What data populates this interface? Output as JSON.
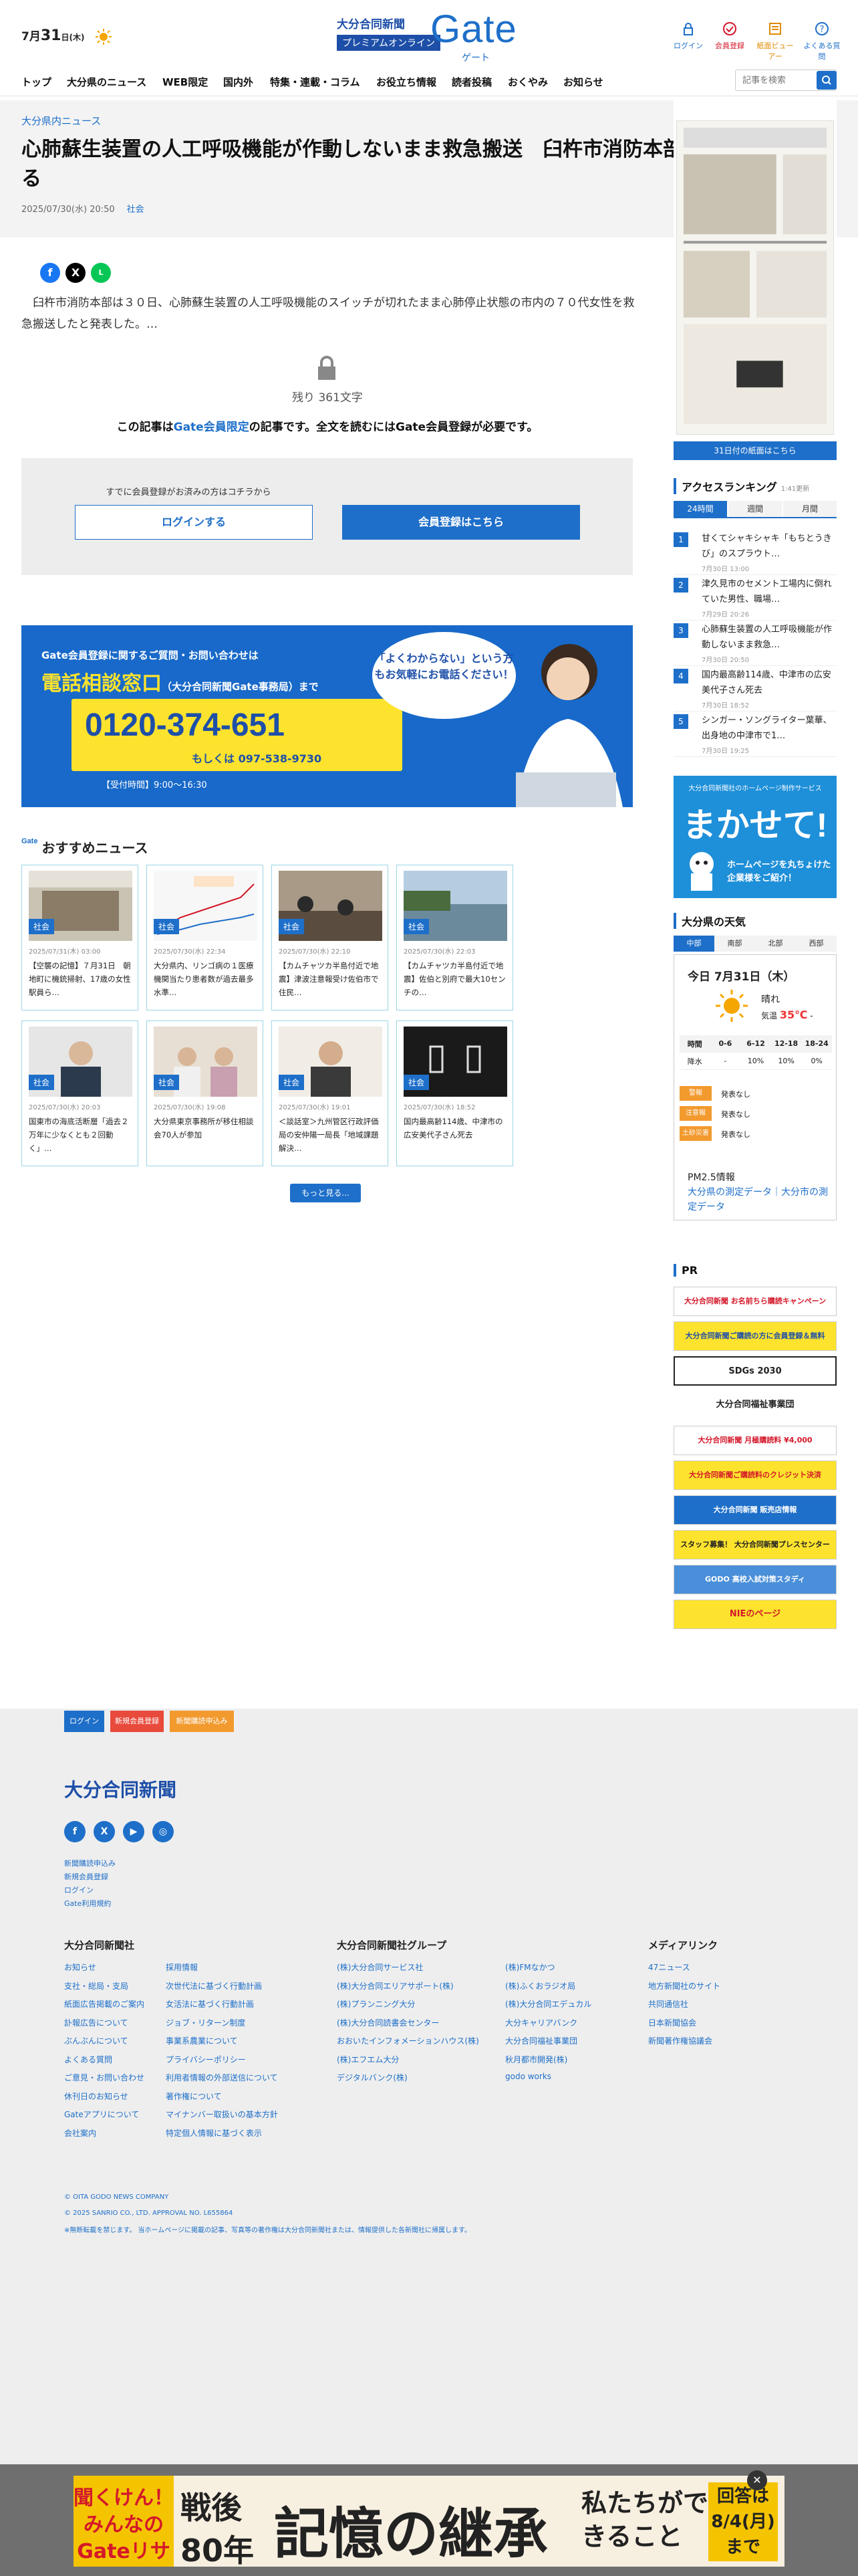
{
  "header": {
    "date_prefix": "7月",
    "date_day": "31",
    "date_suffix": "日(木)",
    "logo_line1": "大分合同新聞",
    "logo_line2": "プレミアムオンライン",
    "logo_gate": "Gate",
    "logo_gate_kana": "ゲート",
    "utilities": [
      "ログイン",
      "会員登録",
      "紙面ビューアー",
      "よくある質問"
    ]
  },
  "nav": {
    "items": [
      "トップ",
      "大分県のニュース",
      "WEB限定",
      "国内外",
      "特集・連載・コラム",
      "お役立ち情報",
      "読者投稿",
      "おくやみ",
      "お知らせ"
    ],
    "search_placeholder": "記事を検索"
  },
  "article": {
    "category_link": "大分県内ニュース",
    "title": "心肺蘇生装置の人工呼吸機能が作動しないまま救急搬送　臼杵市消防本部、隊員が確認怠る",
    "datetime": "2025/07/30(水) 20:50",
    "category": "社会",
    "lead": "　臼杵市消防本部は３０日、心肺蘇生装置の人工呼吸機能のスイッチが切れたまま心肺停止状態の市内の７０代女性を救急搬送したと発表した。…",
    "remaining": "残り 361文字",
    "members_pre": "この記事は",
    "members_gate": "Gate会員限定",
    "members_post": "の記事です。全文を読むにはGate会員登録が必要です。",
    "already_member": "すでに会員登録がお済みの方はコチラから",
    "login_button": "ログインする",
    "register_button": "会員登録はこちら"
  },
  "ad_banner": {
    "line1": "Gate会員登録に関するご質問・お問い合わせは",
    "line2": "電話相談窓口",
    "line2_small": "（大分合同新聞Gate事務局）まで",
    "phone": "0120-374-651",
    "mobile": "もしくは 097-538-9730",
    "hours": "【受付時間】9:00～16:30",
    "bubble": "「よくわからない」という方もお気軽にお電話ください！"
  },
  "recommended": {
    "logo": "Gate",
    "heading": "おすすめニュース",
    "more": "もっと見る...",
    "cards": [
      {
        "badge": "社会",
        "date": "2025/07/31(木) 03:00",
        "title": "【空襲の記憶】７月31日　朝地町に機銃掃射、17歳の女性駅員ら…"
      },
      {
        "badge": "社会",
        "date": "2025/07/30(水) 22:34",
        "title": "大分県内、リンゴ病の１医療機関当たり患者数が過去最多水準…"
      },
      {
        "badge": "社会",
        "date": "2025/07/30(水) 22:10",
        "title": "【カムチャツカ半島付近で地震】津波注意報受け佐伯市で住民…"
      },
      {
        "badge": "社会",
        "date": "2025/07/30(水) 22:03",
        "title": "【カムチャツカ半島付近で地震】佐伯と別府で最大10センチの…"
      },
      {
        "badge": "社会",
        "date": "2025/07/30(水) 20:03",
        "title": "国東市の海底活断層「過去２万年に少なくとも２回動く」…"
      },
      {
        "badge": "社会",
        "date": "2025/07/30(水) 19:08",
        "title": "大分県東京事務所が移住相談会70人が参加"
      },
      {
        "badge": "社会",
        "date": "2025/07/30(水) 19:01",
        "title": "＜談話室＞九州管区行政評価局の安仲陽一局長「地域課題解決…"
      },
      {
        "badge": "社会",
        "date": "2025/07/30(水) 18:52",
        "title": "国内最高齢114歳、中津市の広安美代子さん死去"
      }
    ]
  },
  "sidebar": {
    "paper_caption": "31日付の紙面はこちら",
    "ranking": {
      "heading": "アクセスランキング",
      "updated": "1:41更新",
      "tabs": [
        "24時間",
        "週間",
        "月間"
      ],
      "items": [
        {
          "num": "1",
          "title": "甘くてシャキシャキ「もちとうきび」のスプラウト…",
          "date": "7月30日 13:00"
        },
        {
          "num": "2",
          "title": "津久見市のセメント工場内に倒れていた男性、職場…",
          "date": "7月29日 20:26"
        },
        {
          "num": "3",
          "title": "心肺蘇生装置の人工呼吸機能が作動しないまま救急…",
          "date": "7月30日 20:50"
        },
        {
          "num": "4",
          "title": "国内最高齢114歳、中津市の広安美代子さん死去",
          "date": "7月30日 18:52"
        },
        {
          "num": "5",
          "title": "シンガー・ソングライター葉華、出身地の中津市で1…",
          "date": "7月30日 19:25"
        }
      ]
    },
    "makasete": {
      "top": "大分合同新聞社のホームページ制作サービス",
      "title": "まかせて!",
      "sub": "ホームページを丸ちょけた企業様をご紹介！"
    },
    "weather": {
      "heading": "大分県の天気",
      "tabs": [
        "中部",
        "南部",
        "北部",
        "西部"
      ],
      "date": "今日 7月31日（木）",
      "condition": "晴れ",
      "temp_label": "気温",
      "temp_high": "35℃",
      "temp_low": " - ",
      "table_head": [
        "時間",
        "0-6",
        "6-12",
        "12-18",
        "18-24"
      ],
      "rain_label": "降水",
      "rain_values": [
        "-",
        "10%",
        "10%",
        "0%"
      ],
      "warnings": [
        {
          "label": "警報",
          "text": "発表なし"
        },
        {
          "label": "注意報",
          "text": "発表なし"
        },
        {
          "label": "土砂災害",
          "text": "発表なし"
        }
      ],
      "pm": "PM2.5情報",
      "pm_link": "大分県の測定データ｜大分市の測定データ"
    },
    "pr": {
      "heading": "PR",
      "banners": [
        "大分合同新聞 お名前ちら購読キャンペーン QUOカード3,000円分プレゼント",
        "大分合同新聞ご購読の方に会員登録＆無料",
        "SDGs 2030",
        "大分合同福祉事業団",
        "大分合同新聞 月極購読料 ¥4,000",
        "大分合同新聞ご購読料のクレジット決済",
        "大分合同新聞 販売店情報",
        "スタッフ募集！ 大分合同新聞プレスセンター",
        "GODO 高校入試対策スタディ",
        "NIEのページ"
      ]
    }
  },
  "footer": {
    "top_buttons": [
      "ログイン",
      "新規会員登録",
      "新聞購読申込み"
    ],
    "logo": "大分合同新聞",
    "small_links": [
      "新聞購読申込み",
      "新規会員登録",
      "ログイン",
      "Gate利用規約"
    ],
    "col1_heading": "大分合同新聞社",
    "col1a": [
      "お知らせ",
      "支社・総局・支局",
      "紙面広告掲載のご案内",
      "訃報広告について",
      "ぶんぶんについて",
      "よくある質問",
      "ご意見・お問い合わせ",
      "休刊日のお知らせ",
      "Gateアプリについて",
      "会社案内"
    ],
    "col1b": [
      "採用情報",
      "次世代法に基づく行動計画",
      "女活法に基づく行動計画",
      "ジョブ・リターン制度",
      "事業系農業について",
      "プライバシーポリシー",
      "利用者情報の外部送信について",
      "著作権について",
      "マイナンバー取扱いの基本方針",
      "特定個人情報に基づく表示"
    ],
    "col2_heading": "大分合同新聞社グループ",
    "col2a": [
      "(株)大分合同サービス社",
      "(株)大分合同エリアサポート(株)",
      "(株)プランニング大分",
      "(株)大分合同読書会センター",
      "おおいたインフォメーションハウス(株)",
      "(株)エフエム大分",
      "デジタルバンク(株)"
    ],
    "col2b": [
      "(株)FMなかつ",
      "(株)ふくおラジオ局",
      "(株)大分合同エデュカル",
      "大分キャリアバンク",
      "大分合同福祉事業団",
      "秋月都市開発(株)",
      "godo works"
    ],
    "col3_heading": "メディアリンク",
    "col3": [
      "47ニュース",
      "地方新聞社のサイト",
      "共同通信社",
      "日本新聞協会",
      "新聞著作権協議会"
    ],
    "copyright1": "© OITA GODO NEWS COMPANY",
    "copyright2": "© 2025 SANRIO CO., LTD. APPROVAL NO. L655864",
    "copyright3": "※無断転載を禁じます。 当ホームページに掲載の記事、写真等の著作権は大分合同新聞社または、情報提供した各新聞社に帰属します。"
  },
  "bottom_ad": {
    "left": "聞くけん！みんなのGateリサーチ",
    "mid1": "戦後",
    "mid2": "80年",
    "big": "記憶の継承",
    "right": "私たちができること",
    "box": "回答は8/4(月)まで"
  }
}
